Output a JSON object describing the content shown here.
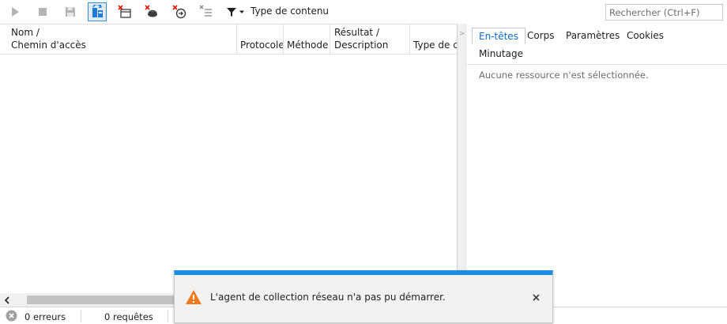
{
  "toolbar": {
    "buttons": [
      {
        "icon": "play-icon",
        "enabled": false
      },
      {
        "icon": "stop-icon",
        "enabled": false
      },
      {
        "icon": "save-icon",
        "enabled": false
      },
      {
        "icon": "clear-on-navigate-icon",
        "active": true
      },
      {
        "icon": "clear-sessions-icon"
      },
      {
        "icon": "clear-cache-icon"
      },
      {
        "icon": "clear-cookies-icon"
      },
      {
        "icon": "clear-entries-icon"
      }
    ],
    "filter_label": "Type de contenu",
    "search_placeholder": "Rechercher (Ctrl+F)"
  },
  "grid": {
    "columns": [
      {
        "line1": "Nom /",
        "line2": "Chemin d'accès"
      },
      {
        "line1": "",
        "line2": "Protocole"
      },
      {
        "line1": "",
        "line2": "Méthode"
      },
      {
        "line1": "Résultat /",
        "line2": "Description"
      },
      {
        "line1": "",
        "line2": "Type de contenu"
      }
    ]
  },
  "details": {
    "tabs": [
      "En-têtes",
      "Corps",
      "Paramètres",
      "Cookies",
      "Minutage"
    ],
    "active_tab": "En-têtes",
    "empty_message": "Aucune ressource n'est sélectionnée."
  },
  "status": {
    "errors": "0 erreurs",
    "requests": "0 requêtes"
  },
  "notification": {
    "message": "L'agent de collection réseau n'a pas pu démarrer."
  },
  "colors": {
    "accent": "#1e8ee0",
    "active_tab_text": "#0e6ac8",
    "warning": "#f07b1e"
  }
}
